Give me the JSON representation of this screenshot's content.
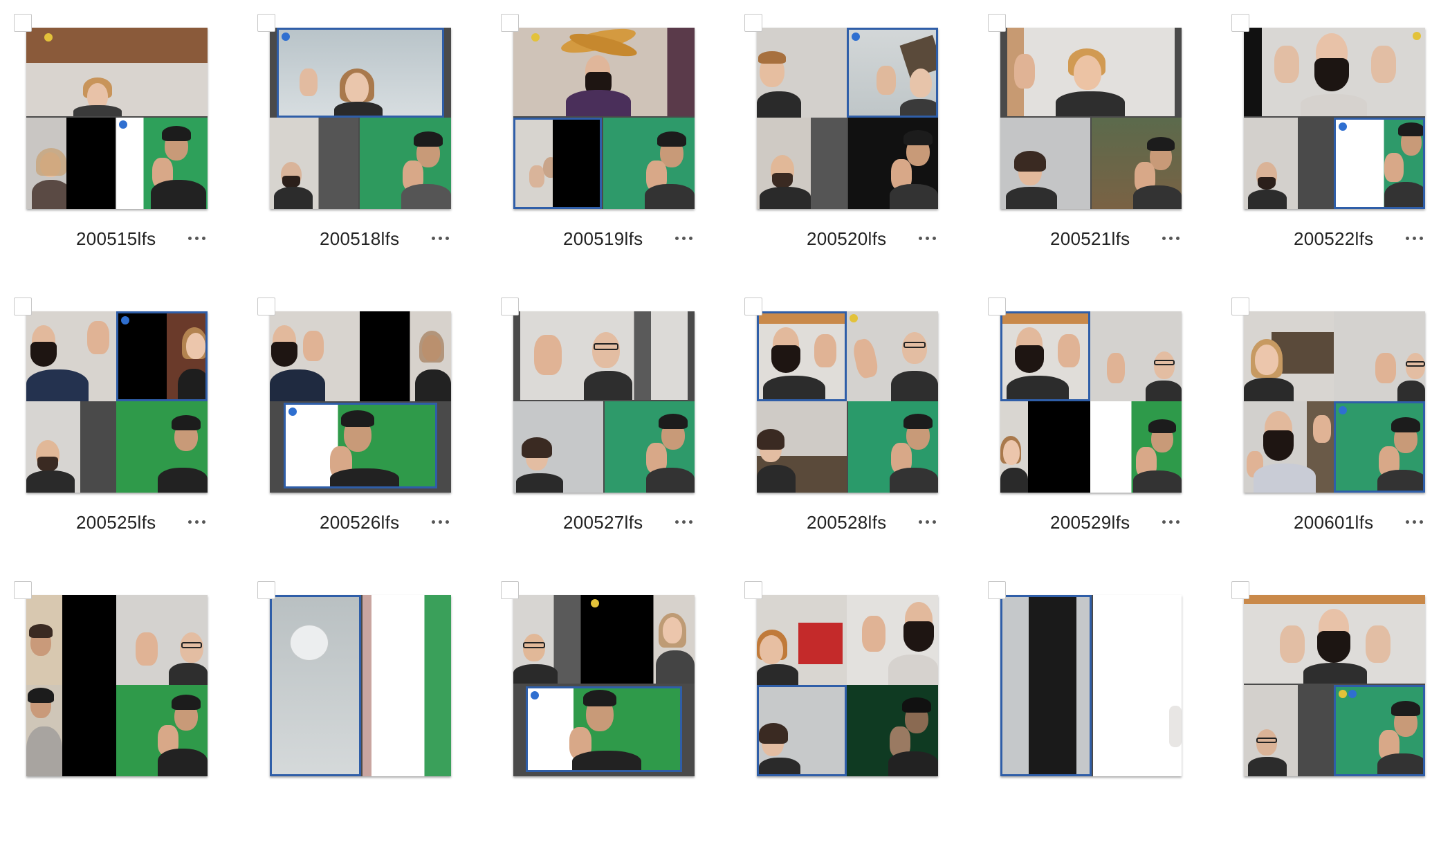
{
  "items": [
    {
      "name": "200515lfs"
    },
    {
      "name": "200518lfs"
    },
    {
      "name": "200519lfs"
    },
    {
      "name": "200520lfs"
    },
    {
      "name": "200521lfs"
    },
    {
      "name": "200522lfs"
    },
    {
      "name": "200525lfs"
    },
    {
      "name": "200526lfs"
    },
    {
      "name": "200527lfs"
    },
    {
      "name": "200528lfs"
    },
    {
      "name": "200529lfs"
    },
    {
      "name": "200601lfs"
    },
    {
      "name": ""
    },
    {
      "name": ""
    },
    {
      "name": ""
    },
    {
      "name": ""
    },
    {
      "name": ""
    },
    {
      "name": ""
    }
  ],
  "icons": {
    "more": "more-options-icon",
    "select": "checkbox-icon"
  },
  "colors": {
    "active_border": "#2f5ea8",
    "tile_frame": "#4a4a4a",
    "green_screen": "#2f9a5a"
  }
}
